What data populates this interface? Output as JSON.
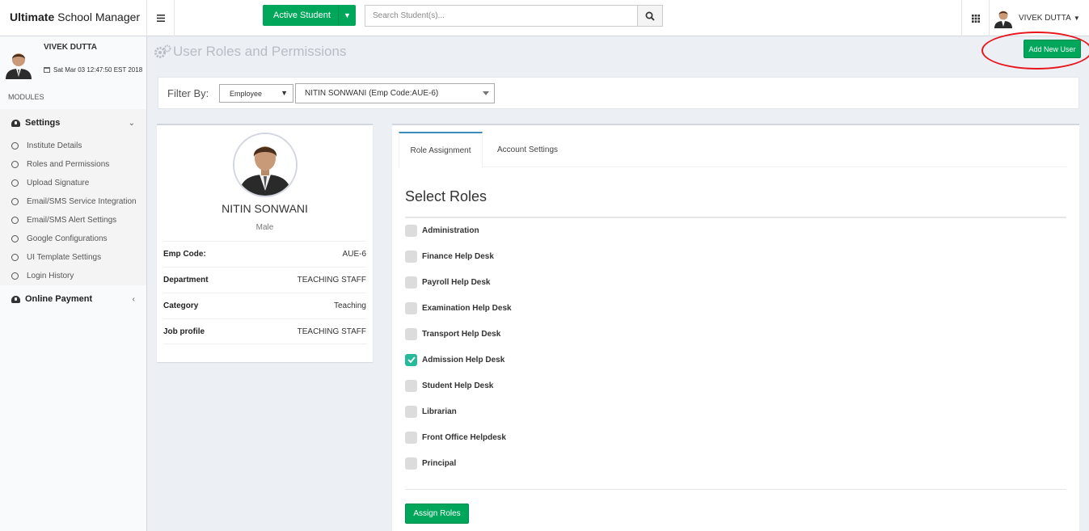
{
  "app": {
    "brand_bold": "Ultimate",
    "brand_rest": " School Manager"
  },
  "header": {
    "active_student_label": "Active Student",
    "search": {
      "placeholder": "Search Student(s)...",
      "value": ""
    },
    "user_name": "VIVEK DUTTA"
  },
  "sidebar": {
    "user_name": "VIVEK DUTTA",
    "date": "Sat Mar 03 12:47:50 EST 2018",
    "modules_label": "MODULES",
    "settings_label": "Settings",
    "settings_items": [
      {
        "label": "Institute Details"
      },
      {
        "label": "Roles and Permissions"
      },
      {
        "label": "Upload Signature"
      },
      {
        "label": "Email/SMS Service Integration"
      },
      {
        "label": "Email/SMS Alert Settings"
      },
      {
        "label": "Google Configurations"
      },
      {
        "label": "UI Template Settings"
      },
      {
        "label": "Login History"
      }
    ],
    "online_payment_label": "Online Payment"
  },
  "page": {
    "title": "User Roles and Permissions",
    "add_user_label": "Add New User"
  },
  "filter": {
    "label": "Filter By:",
    "type_value": "Employee",
    "employee_value": "NITIN SONWANI (Emp Code:AUE-6)"
  },
  "profile": {
    "name": "NITIN SONWANI",
    "gender": "Male",
    "fields": [
      {
        "key": "Emp Code:",
        "value": "AUE-6"
      },
      {
        "key": "Department",
        "value": "TEACHING STAFF"
      },
      {
        "key": "Category",
        "value": "Teaching"
      },
      {
        "key": "Job profile",
        "value": "TEACHING STAFF"
      }
    ]
  },
  "roles_panel": {
    "tabs": [
      {
        "label": "Role Assignment",
        "active": true
      },
      {
        "label": "Account Settings",
        "active": false
      }
    ],
    "heading": "Select Roles",
    "roles": [
      {
        "label": "Administration",
        "checked": false
      },
      {
        "label": "Finance Help Desk",
        "checked": false
      },
      {
        "label": "Payroll Help Desk",
        "checked": false
      },
      {
        "label": "Examination Help Desk",
        "checked": false
      },
      {
        "label": "Transport Help Desk",
        "checked": false
      },
      {
        "label": "Admission Help Desk",
        "checked": true
      },
      {
        "label": "Student Help Desk",
        "checked": false
      },
      {
        "label": "Librarian",
        "checked": false
      },
      {
        "label": "Front Office Helpdesk",
        "checked": false
      },
      {
        "label": "Principal",
        "checked": false
      }
    ],
    "assign_label": "Assign Roles"
  },
  "colors": {
    "accent_green": "#00a65a",
    "checkbox_checked": "#26b99a",
    "annotation_red": "#e8141b",
    "tab_active": "#3c8dbc"
  }
}
